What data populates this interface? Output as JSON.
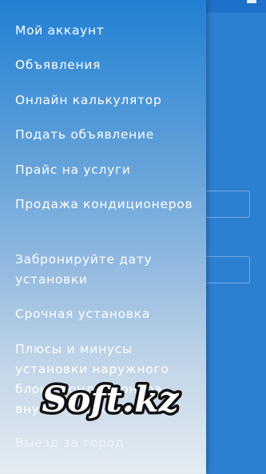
{
  "drawer": {
    "items": [
      {
        "label": "Мой аккаунт"
      },
      {
        "label": "Объявления"
      },
      {
        "label": "Онлайн калькулятор"
      },
      {
        "label": "Подать объявление"
      },
      {
        "label": "Прайс на услуги"
      },
      {
        "label": "Продажа кондиционеров"
      },
      {
        "label": "Забронируйте дату установки"
      },
      {
        "label": "Срочная установка"
      },
      {
        "label": "Плюсы и минусы установки наружного блока кондиционера внутри балкона"
      },
      {
        "label": "Выезд за город"
      }
    ]
  },
  "watermark": {
    "text": "Soft.kz"
  },
  "colors": {
    "drawer_top": "#2180d4",
    "drawer_bottom": "#e4ebf2",
    "app_background": "#2d7fd2",
    "app_toolbar": "#1f70c8"
  }
}
